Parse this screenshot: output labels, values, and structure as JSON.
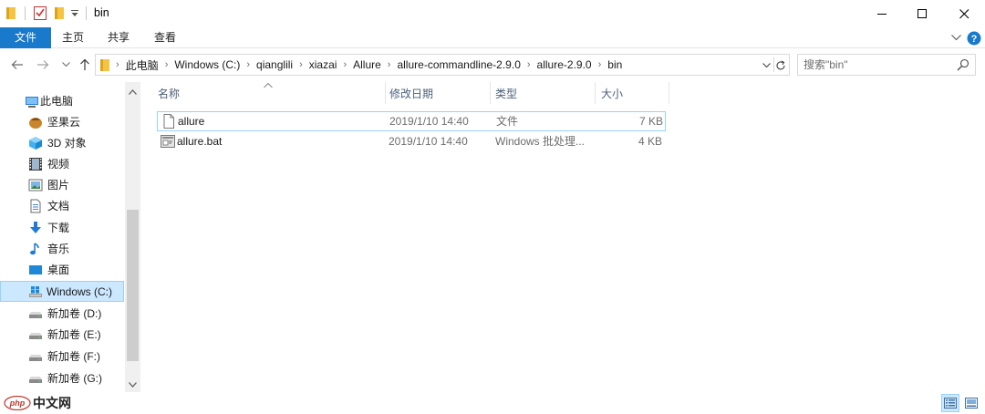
{
  "window": {
    "title": "bin",
    "minimize_label": "Minimize",
    "maximize_label": "Maximize",
    "close_label": "Close"
  },
  "ribbon": {
    "tabs": [
      {
        "label": "文件"
      },
      {
        "label": "主页"
      },
      {
        "label": "共享"
      },
      {
        "label": "查看"
      }
    ]
  },
  "address": {
    "crumbs": [
      "此电脑",
      "Windows (C:)",
      "qianglili",
      "xiazai",
      "Allure",
      "allure-commandline-2.9.0",
      "allure-2.9.0",
      "bin"
    ]
  },
  "search": {
    "placeholder": "搜索\"bin\""
  },
  "nav": {
    "items": [
      {
        "label": "此电脑",
        "icon": "computer-icon"
      },
      {
        "label": "坚果云",
        "icon": "nutstore-icon"
      },
      {
        "label": "3D 对象",
        "icon": "3d-objects-icon"
      },
      {
        "label": "视频",
        "icon": "video-icon"
      },
      {
        "label": "图片",
        "icon": "pictures-icon"
      },
      {
        "label": "文档",
        "icon": "documents-icon"
      },
      {
        "label": "下载",
        "icon": "download-icon"
      },
      {
        "label": "音乐",
        "icon": "music-icon"
      },
      {
        "label": "桌面",
        "icon": "desktop-icon"
      },
      {
        "label": "Windows (C:)",
        "icon": "windows-drive-icon",
        "selected": true
      },
      {
        "label": "新加卷 (D:)",
        "icon": "drive-icon"
      },
      {
        "label": "新加卷 (E:)",
        "icon": "drive-icon"
      },
      {
        "label": "新加卷 (F:)",
        "icon": "drive-icon"
      },
      {
        "label": "新加卷 (G:)",
        "icon": "drive-icon"
      }
    ]
  },
  "filelist": {
    "columns": {
      "name": "名称",
      "modified": "修改日期",
      "type": "类型",
      "size": "大小"
    },
    "rows": [
      {
        "name": "allure",
        "modified": "2019/1/10 14:40",
        "type": "文件",
        "size": "7 KB",
        "icon": "file-icon"
      },
      {
        "name": "allure.bat",
        "modified": "2019/1/10 14:40",
        "type": "Windows 批处理...",
        "size": "4 KB",
        "icon": "batch-file-icon"
      }
    ]
  },
  "watermark": {
    "text": "中文网",
    "logo_text": "php"
  },
  "colors": {
    "accent": "#1979ca",
    "selection": "#cce8ff",
    "selection_border": "#99d1ff"
  }
}
